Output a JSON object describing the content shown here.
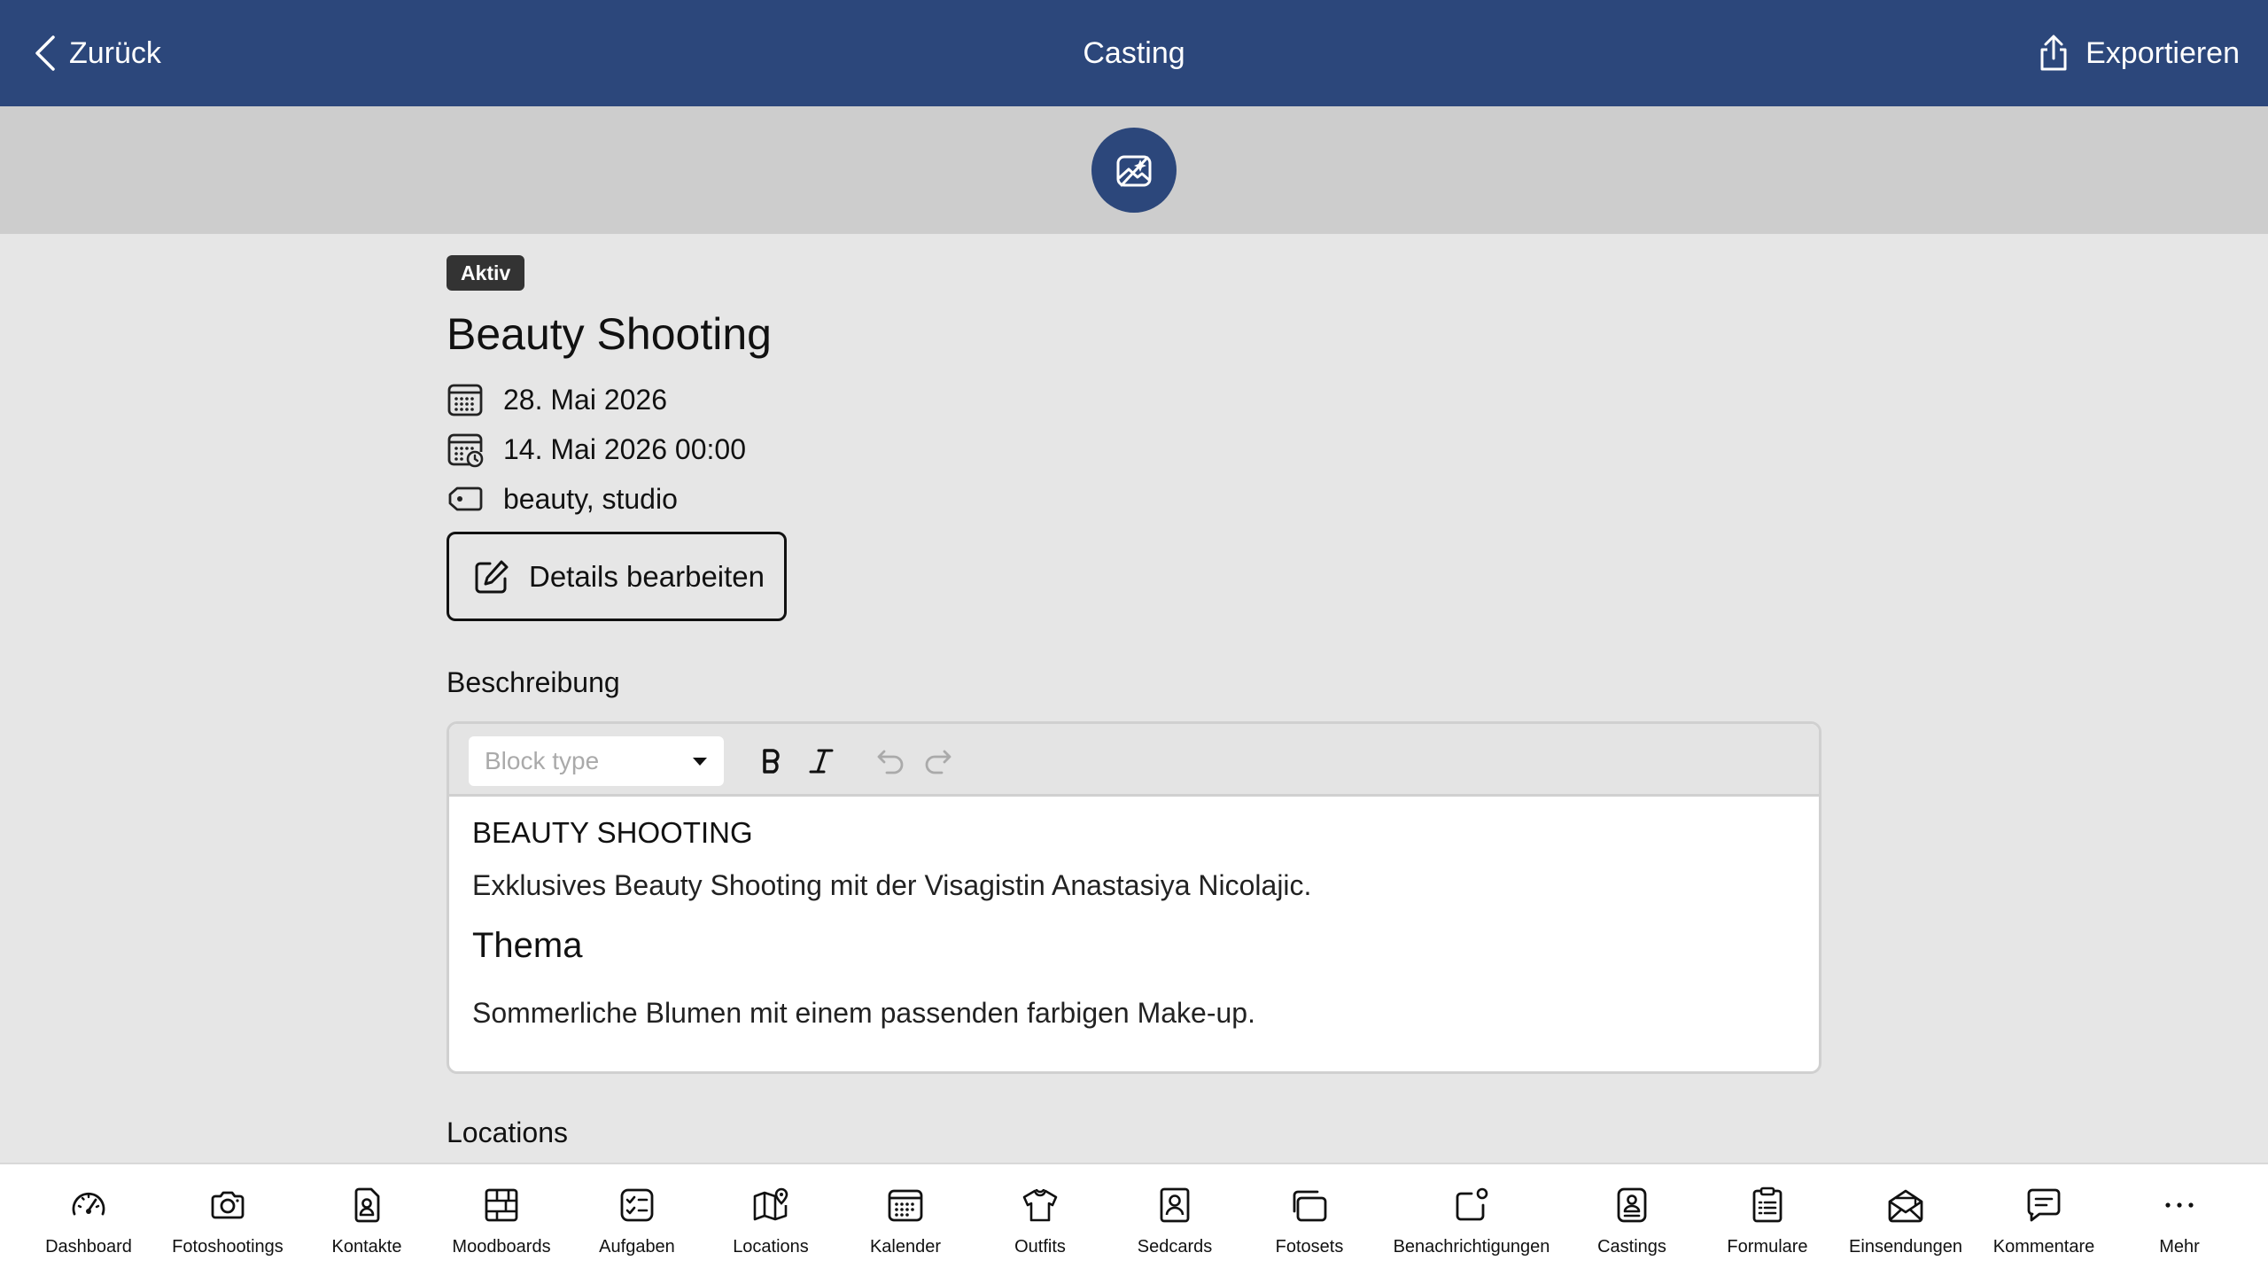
{
  "header": {
    "back_label": "Zurück",
    "title": "Casting",
    "export_label": "Exportieren",
    "background": "#2c477b"
  },
  "casting": {
    "status": "Aktiv",
    "name": "Beauty Shooting",
    "date": "28. Mai 2026",
    "deadline": "14. Mai 2026 00:00",
    "tags": "beauty, studio",
    "edit_label": "Details bearbeiten"
  },
  "description": {
    "label": "Beschreibung",
    "block_type_placeholder": "Block type",
    "content": {
      "heading_upper": "BEAUTY SHOOTING",
      "paragraph1": "Exklusives Beauty Shooting mit der Visagistin Anastasiya Nicolajic.",
      "heading2": "Thema",
      "paragraph2": "Sommerliche Blumen mit einem passenden farbigen Make-up."
    }
  },
  "locations": {
    "label": "Locations"
  },
  "bottom_nav": [
    {
      "label": "Dashboard",
      "icon": "gauge-icon"
    },
    {
      "label": "Fotoshootings",
      "icon": "camera-icon"
    },
    {
      "label": "Kontakte",
      "icon": "contact-icon"
    },
    {
      "label": "Moodboards",
      "icon": "moodboard-icon"
    },
    {
      "label": "Aufgaben",
      "icon": "tasks-icon"
    },
    {
      "label": "Locations",
      "icon": "map-icon"
    },
    {
      "label": "Kalender",
      "icon": "calendar-icon"
    },
    {
      "label": "Outfits",
      "icon": "shirt-icon"
    },
    {
      "label": "Sedcards",
      "icon": "sedcard-icon"
    },
    {
      "label": "Fotosets",
      "icon": "photosets-icon"
    },
    {
      "label": "Benachrichtigungen",
      "icon": "notification-icon"
    },
    {
      "label": "Castings",
      "icon": "casting-icon"
    },
    {
      "label": "Formulare",
      "icon": "form-icon"
    },
    {
      "label": "Einsendungen",
      "icon": "mail-icon"
    },
    {
      "label": "Kommentare",
      "icon": "comment-icon"
    },
    {
      "label": "Mehr",
      "icon": "more-icon"
    }
  ]
}
